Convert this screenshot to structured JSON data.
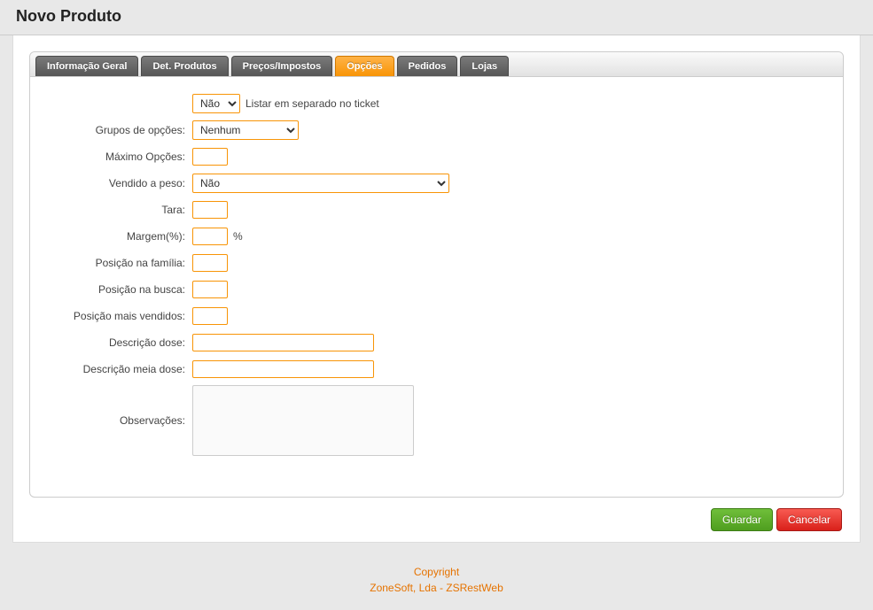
{
  "header": {
    "title": "Novo Produto"
  },
  "tabs": [
    {
      "label": "Informação Geral",
      "active": false
    },
    {
      "label": "Det. Produtos",
      "active": false
    },
    {
      "label": "Preços/Impostos",
      "active": false
    },
    {
      "label": "Opções",
      "active": true
    },
    {
      "label": "Pedidos",
      "active": false
    },
    {
      "label": "Lojas",
      "active": false
    }
  ],
  "form": {
    "listar_separado": {
      "value": "Não",
      "suffix": "Listar em separado no ticket"
    },
    "grupos_opcoes": {
      "label": "Grupos de opções:",
      "value": "Nenhum"
    },
    "maximo_opcoes": {
      "label": "Máximo Opções:",
      "value": ""
    },
    "vendido_peso": {
      "label": "Vendido a peso:",
      "value": "Não"
    },
    "tara": {
      "label": "Tara:",
      "value": ""
    },
    "margem": {
      "label": "Margem(%):",
      "value": "",
      "suffix": "%"
    },
    "posicao_familia": {
      "label": "Posição na família:",
      "value": ""
    },
    "posicao_busca": {
      "label": "Posição na busca:",
      "value": ""
    },
    "posicao_vendidos": {
      "label": "Posição mais vendidos:",
      "value": ""
    },
    "descricao_dose": {
      "label": "Descrição dose:",
      "value": ""
    },
    "descricao_meia": {
      "label": "Descrição meia dose:",
      "value": ""
    },
    "observacoes": {
      "label": "Observações:",
      "value": ""
    }
  },
  "buttons": {
    "save": "Guardar",
    "cancel": "Cancelar"
  },
  "footer": {
    "line1": "Copyright",
    "line2": "ZoneSoft, Lda - ZSRestWeb"
  }
}
